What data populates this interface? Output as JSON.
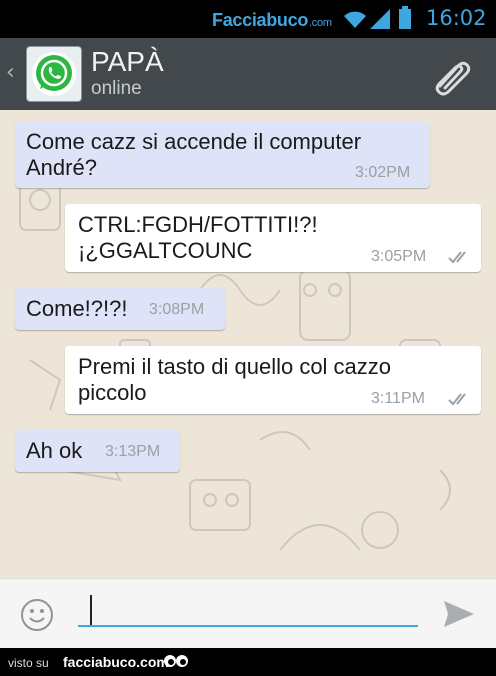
{
  "statusbar": {
    "brand_main": "Facciabuco",
    "brand_suffix": ".com",
    "time": "16:02",
    "icons": [
      "wifi-icon",
      "signal-icon",
      "battery-icon"
    ],
    "accent": "#3fa7e0"
  },
  "header": {
    "contact_name": "PAPÀ",
    "status": "online",
    "back_icon": "chevron-left-icon",
    "avatar_icon": "whatsapp-logo",
    "attach_icon": "paperclip-icon",
    "background": "#42484b"
  },
  "messages": [
    {
      "direction": "incoming",
      "text": "Come cazz si accende il computer André?",
      "time": "3:02PM"
    },
    {
      "direction": "outgoing",
      "text": "CTRL:FGDH/FOTTITI!?! ¡¿GGALTCOUNC",
      "time": "3:05PM",
      "delivered": true
    },
    {
      "direction": "incoming",
      "text": "Come!?!?!",
      "time": "3:08PM"
    },
    {
      "direction": "outgoing",
      "text": "Premi il tasto di quello col cazzo piccolo",
      "time": "3:11PM",
      "delivered": true
    },
    {
      "direction": "incoming",
      "text": "Ah ok",
      "time": "3:13PM"
    }
  ],
  "composer": {
    "value": "",
    "emoji_icon": "smiley-icon",
    "send_icon": "send-icon"
  },
  "footer": {
    "visto": "visto su",
    "site": "facciabuco.com"
  },
  "colors": {
    "incoming_bubble": "#dfe3f7",
    "outgoing_bubble": "#ffffff",
    "chat_background": "#ece5d8"
  }
}
